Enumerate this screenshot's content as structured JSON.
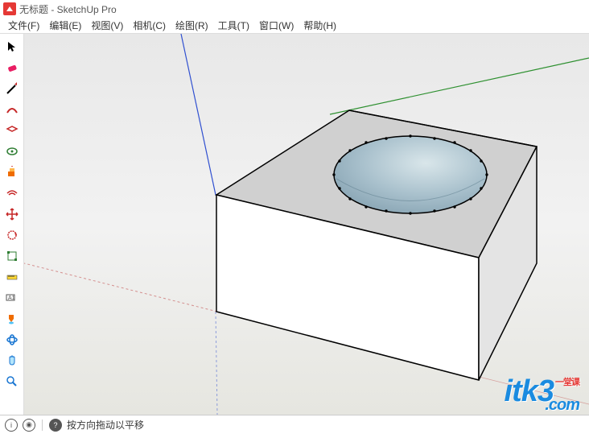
{
  "title": "无标题 - SketchUp Pro",
  "menu": [
    {
      "label": "文件(F)"
    },
    {
      "label": "编辑(E)"
    },
    {
      "label": "视图(V)"
    },
    {
      "label": "相机(C)"
    },
    {
      "label": "绘图(R)"
    },
    {
      "label": "工具(T)"
    },
    {
      "label": "窗口(W)"
    },
    {
      "label": "帮助(H)"
    }
  ],
  "tools": [
    {
      "name": "select-tool",
      "icon": "arrow"
    },
    {
      "name": "eraser-tool",
      "icon": "eraser"
    },
    {
      "name": "line-tool",
      "icon": "pencil"
    },
    {
      "name": "arc-tool",
      "icon": "arc"
    },
    {
      "name": "rectangle-tool",
      "icon": "rect"
    },
    {
      "name": "circle-tool",
      "icon": "circle"
    },
    {
      "name": "pushpull-tool",
      "icon": "pushpull"
    },
    {
      "name": "offset-tool",
      "icon": "offset"
    },
    {
      "name": "move-tool",
      "icon": "move"
    },
    {
      "name": "rotate-tool",
      "icon": "rotate"
    },
    {
      "name": "scale-tool",
      "icon": "scale"
    },
    {
      "name": "tape-tool",
      "icon": "tape"
    },
    {
      "name": "text-tool",
      "icon": "text"
    },
    {
      "name": "paint-tool",
      "icon": "paint"
    },
    {
      "name": "orbit-tool",
      "icon": "orbit"
    },
    {
      "name": "pan-tool",
      "icon": "pan"
    },
    {
      "name": "zoom-tool",
      "icon": "zoom"
    }
  ],
  "status": {
    "hint": "按方向拖动以平移"
  },
  "watermark": {
    "brand": "itk3",
    "sub": "一堂课",
    "domain": ".com"
  }
}
